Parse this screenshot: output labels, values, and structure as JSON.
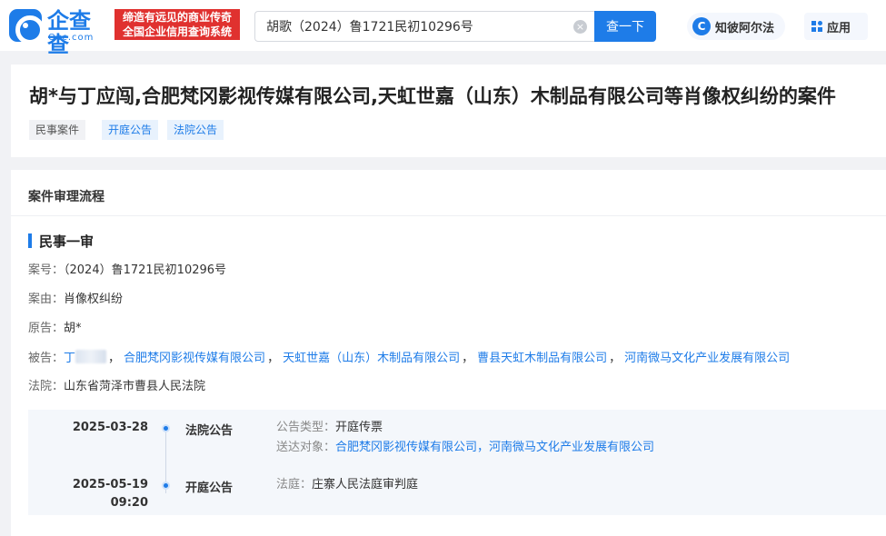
{
  "header": {
    "logo_name": "企查查",
    "logo_sub": "Qcc.com",
    "slogan_line1": "缔造有远见的商业传奇",
    "slogan_line2": "全国企业信用查询系统",
    "search_value": "胡歌（2024）鲁1721民初10296号",
    "clear_glyph": "×",
    "search_button": "查一下",
    "zhibi_label": "知彼阿尔法",
    "zhibi_glyph": "C",
    "apps_label": "应用"
  },
  "case": {
    "title": "胡*与丁应闯,合肥梵冈影视传媒有限公司,天虹世嘉（山东）木制品有限公司等肖像权纠纷的案件",
    "tags": [
      "民事案件",
      "开庭公告",
      "法院公告"
    ]
  },
  "process": {
    "section_title": "案件审理流程",
    "stage_title": "民事一审",
    "case_no_label": "案号：",
    "case_no": "（2024）鲁1721民初10296号",
    "cause_label": "案由：",
    "cause": "肖像权纠纷",
    "plaintiff_label": "原告：",
    "plaintiff": "胡*",
    "defendant_label": "被告：",
    "defendants": [
      "丁",
      "合肥梵冈影视传媒有限公司",
      "天虹世嘉（山东）木制品有限公司",
      "曹县天虹木制品有限公司",
      "河南微马文化产业发展有限公司"
    ],
    "separator": "，",
    "court_label": "法院：",
    "court": "山东省菏泽市曹县人民法院"
  },
  "timeline": [
    {
      "date": "2025-03-28",
      "time": "",
      "type": "法院公告",
      "detail_label_1": "公告类型：",
      "detail_value_1": "开庭传票",
      "detail_label_2": "送达对象：",
      "detail_value_2": "合肥梵冈影视传媒有限公司，河南微马文化产业发展有限公司"
    },
    {
      "date": "2025-05-19",
      "time": "09:20",
      "type": "开庭公告",
      "detail_label_1": "法庭：",
      "detail_value_1": "庄寨人民法庭审判庭"
    }
  ],
  "colors": {
    "brand": "#1e7ce8",
    "slogan_bg": "#e0312f"
  }
}
